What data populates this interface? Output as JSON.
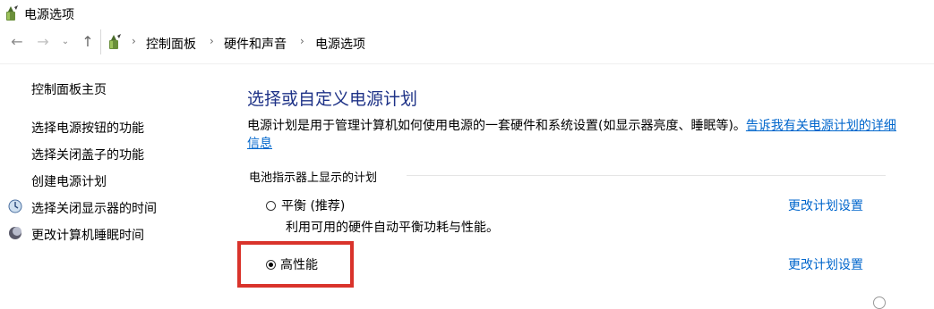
{
  "window": {
    "title": "电源选项",
    "icon": "power-options-icon"
  },
  "address_bar": {
    "back_icon": "back-arrow-icon",
    "forward_icon": "forward-arrow-icon",
    "recent_icon": "chevron-down-icon",
    "up_icon": "up-arrow-icon",
    "crumbs": [
      "控制面板",
      "硬件和声音",
      "电源选项"
    ]
  },
  "sidebar": {
    "home": "控制面板主页",
    "items": [
      "选择电源按钮的功能",
      "选择关闭盖子的功能",
      "创建电源计划",
      "选择关闭显示器的时间",
      "更改计算机睡眠时间"
    ]
  },
  "main": {
    "title": "选择或自定义电源计划",
    "description": "电源计划是用于管理计算机如何使用电源的一套硬件和系统设置(如显示器亮度、睡眠等)。",
    "learn_more_link": "告诉我有关电源计划的详细信息",
    "group_label": "电池指示器上显示的计划",
    "plans": [
      {
        "name": "平衡 (推荐)",
        "description": "利用可用的硬件自动平衡功耗与性能。",
        "selected": false,
        "change_link": "更改计划设置"
      },
      {
        "name": "高性能",
        "selected": true,
        "change_link": "更改计划设置"
      }
    ]
  },
  "colors": {
    "title_blue": "#1e3287",
    "link_blue": "#0066cc",
    "highlight_red": "#d9332b"
  }
}
